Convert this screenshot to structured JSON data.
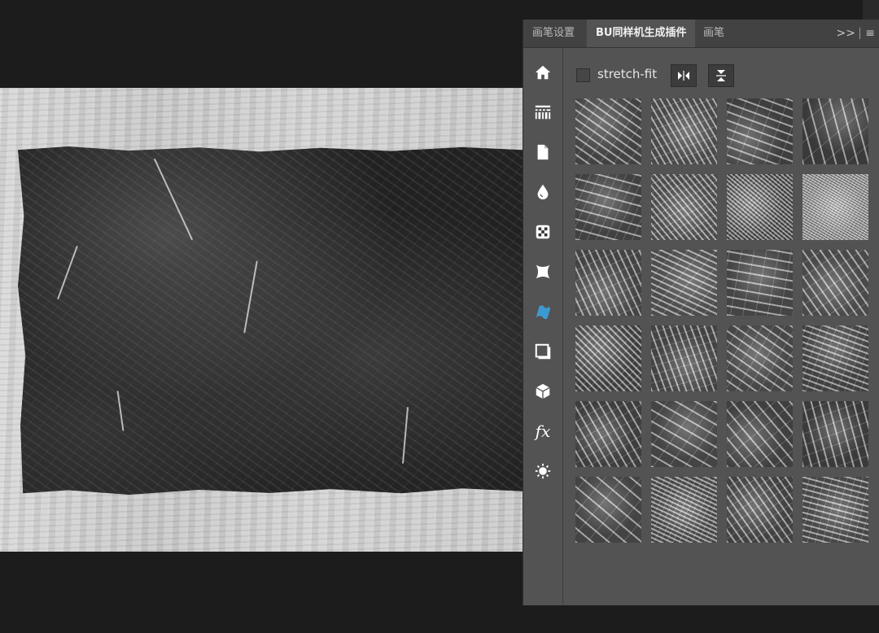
{
  "tabs": [
    {
      "label": "画笔设置",
      "active": false
    },
    {
      "label": "BU同样机生成插件",
      "active": true
    },
    {
      "label": "画笔",
      "active": false
    }
  ],
  "tabbar": {
    "collapse_label": ">>",
    "menu_label": "≡"
  },
  "toolbar": {
    "tools": [
      "home-icon",
      "barcode-icon",
      "document-icon",
      "droplet-icon",
      "checker-icon",
      "warp-icon",
      "wave-icon",
      "frame-icon",
      "cube-icon",
      "fx-icon",
      "sun-icon"
    ],
    "active": "wave-icon",
    "fx_label": "fx"
  },
  "controls": {
    "checkbox_label": "stretch-fit",
    "checked": false
  },
  "texture_grid": {
    "columns": 4,
    "rows": 6,
    "count": 24
  },
  "colors": {
    "accent": "#3d9ad1",
    "panel": "#535353",
    "tabbar": "#424242"
  }
}
